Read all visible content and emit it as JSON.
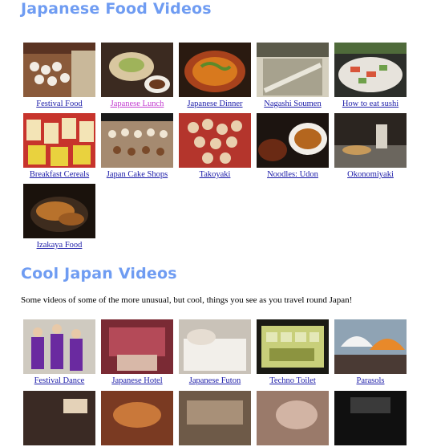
{
  "sections": {
    "food": {
      "title": "Japanese Food Videos",
      "videos": [
        {
          "label": "Festival Food",
          "visited": false,
          "icon": "festival-food-thumbnail"
        },
        {
          "label": "Japanese Lunch",
          "visited": true,
          "icon": "japanese-lunch-thumbnail"
        },
        {
          "label": "Japanese Dinner",
          "visited": false,
          "icon": "japanese-dinner-thumbnail"
        },
        {
          "label": "Nagashi Soumen",
          "visited": false,
          "icon": "nagashi-soumen-thumbnail"
        },
        {
          "label": "How to eat sushi",
          "visited": false,
          "icon": "sushi-thumbnail"
        },
        {
          "label": "Breakfast Cereals",
          "visited": false,
          "icon": "breakfast-cereals-thumbnail"
        },
        {
          "label": "Japan Cake Shops",
          "visited": false,
          "icon": "cake-shops-thumbnail"
        },
        {
          "label": "Takoyaki",
          "visited": false,
          "icon": "takoyaki-thumbnail"
        },
        {
          "label": "Noodles: Udon",
          "visited": false,
          "icon": "udon-thumbnail"
        },
        {
          "label": "Okonomiyaki",
          "visited": false,
          "icon": "okonomiyaki-thumbnail"
        },
        {
          "label": "Izakaya Food",
          "visited": false,
          "icon": "izakaya-food-thumbnail"
        }
      ]
    },
    "cool": {
      "title": "Cool Japan Videos",
      "intro": "Some videos of some of the more unusual, but cool, things you see as you travel round Japan!",
      "videos": [
        {
          "label": "Festival Dance",
          "visited": false,
          "icon": "festival-dance-thumbnail"
        },
        {
          "label": "Japanese Hotel",
          "visited": false,
          "icon": "japanese-hotel-thumbnail"
        },
        {
          "label": "Japanese Futon",
          "visited": false,
          "icon": "futon-thumbnail"
        },
        {
          "label": "Techno Toilet",
          "visited": false,
          "icon": "techno-toilet-thumbnail"
        },
        {
          "label": "Parasols",
          "visited": false,
          "icon": "parasols-thumbnail"
        },
        {
          "label": "",
          "visited": false,
          "icon": "video-thumbnail"
        },
        {
          "label": "",
          "visited": false,
          "icon": "video-thumbnail"
        },
        {
          "label": "",
          "visited": false,
          "icon": "video-thumbnail"
        },
        {
          "label": "",
          "visited": false,
          "icon": "video-thumbnail"
        },
        {
          "label": "",
          "visited": false,
          "icon": "video-thumbnail"
        }
      ]
    }
  },
  "colors": {
    "heading": "#6f9cf2",
    "link": "#1b1ba8",
    "visited_link": "#c23ccf"
  }
}
